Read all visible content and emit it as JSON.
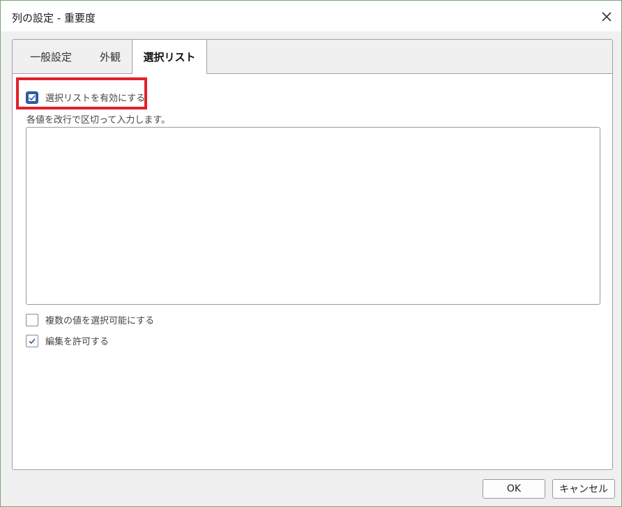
{
  "window": {
    "title": "列の設定 - 重要度"
  },
  "tabs": [
    {
      "label": "一般設定",
      "active": false
    },
    {
      "label": "外観",
      "active": false
    },
    {
      "label": "選択リスト",
      "active": true
    }
  ],
  "select_list": {
    "enable_label": "選択リストを有効にする",
    "enable_checked": true,
    "hint": "各値を改行で区切って入力します。",
    "values_text": "",
    "multi_select_label": "複数の値を選択可能にする",
    "multi_select_checked": false,
    "allow_edit_label": "編集を許可する",
    "allow_edit_checked": true
  },
  "buttons": {
    "ok_label": "OK",
    "cancel_label": "キャンセル"
  },
  "colors": {
    "highlight": "#e0212b",
    "check": "#2c5aa0"
  },
  "icons": {
    "close": "close-icon",
    "check": "checkmark-icon"
  }
}
